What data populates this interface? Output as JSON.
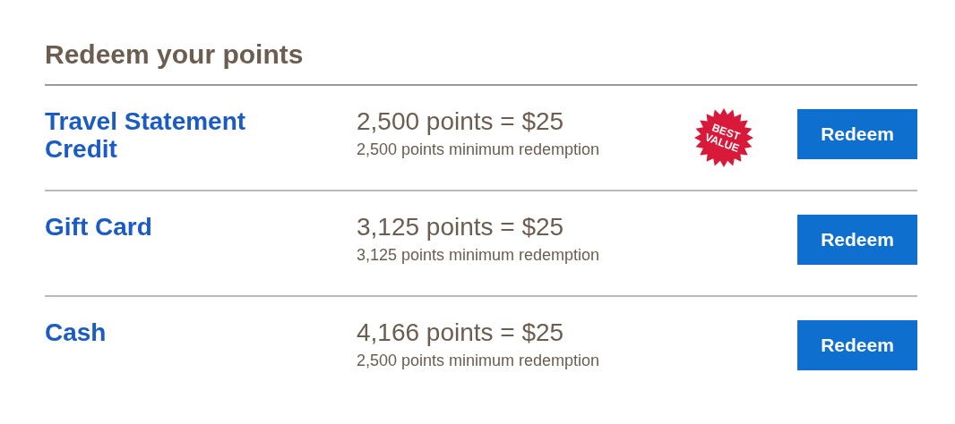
{
  "title": "Redeem your points",
  "options": [
    {
      "name": "Travel Statement Credit",
      "rate": "2,500 points = $25",
      "minimum": "2,500 points minimum redemption",
      "badge": [
        "BEST",
        "VALUE"
      ],
      "button": "Redeem"
    },
    {
      "name": "Gift Card",
      "rate": "3,125 points = $25",
      "minimum": "3,125 points minimum redemption",
      "button": "Redeem"
    },
    {
      "name": "Cash",
      "rate": "4,166 points = $25",
      "minimum": "2,500 points minimum redemption",
      "button": "Redeem"
    }
  ]
}
